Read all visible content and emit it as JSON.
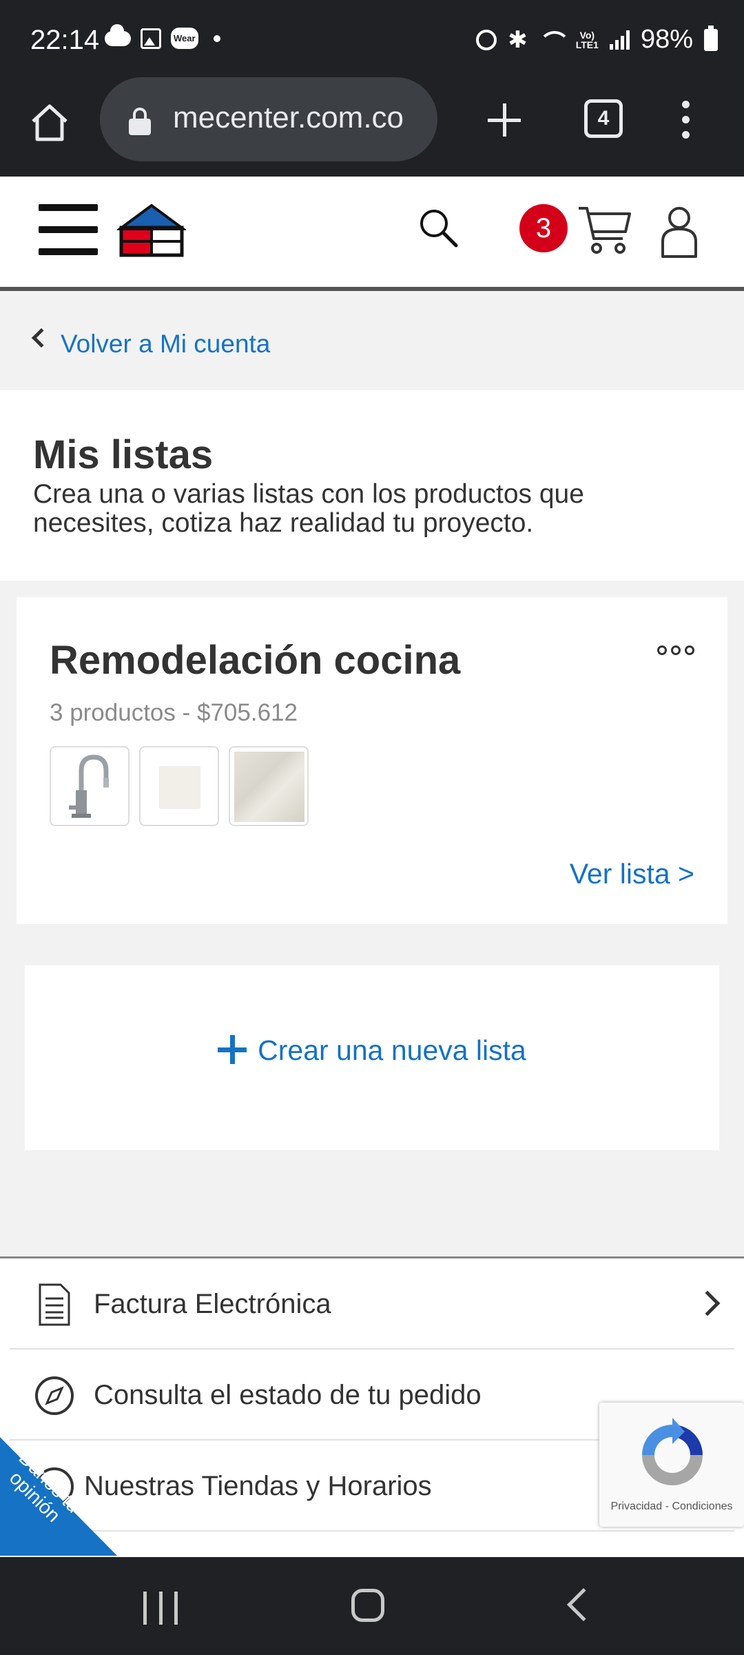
{
  "status_bar": {
    "time": "22:14",
    "wear_label": "Wear",
    "volte_label_1": "Vo)",
    "volte_label_2": "LTE1",
    "battery": "98%"
  },
  "browser": {
    "url": "mecenter.com.co",
    "tab_count": "4"
  },
  "header": {
    "cart_count": "3",
    "logo_colors": {
      "roof": "#1b5fb0",
      "left": "#e0001b",
      "right": "#f5d400"
    }
  },
  "back_link": "Volver a Mi cuenta",
  "intro": {
    "title": "Mis listas",
    "description": "Crea una o varias listas con los productos que necesites, cotiza haz realidad tu proyecto."
  },
  "list_card": {
    "title": "Remodelación cocina",
    "subtitle": "3 productos - $705.612",
    "thumbnails": [
      "faucet",
      "white-tile",
      "marble-tile"
    ],
    "view_link": "Ver lista >"
  },
  "create_list": "Crear una nueva lista",
  "footer_menu": {
    "items": [
      {
        "label": "Factura Electrónica",
        "icon": "document-icon"
      },
      {
        "label": "Consulta el estado de tu pedido",
        "icon": "compass-icon"
      },
      {
        "label": "Nuestras Tiendas y Horarios",
        "icon": "store-icon"
      }
    ]
  },
  "feedback": {
    "label": "Danos tu opinión"
  },
  "recaptcha": {
    "privacy": "Privacidad",
    "separator": "-",
    "terms": "Condiciones"
  },
  "colors": {
    "link": "#1572c4",
    "badge": "#d40019",
    "system_bar": "#202124"
  }
}
